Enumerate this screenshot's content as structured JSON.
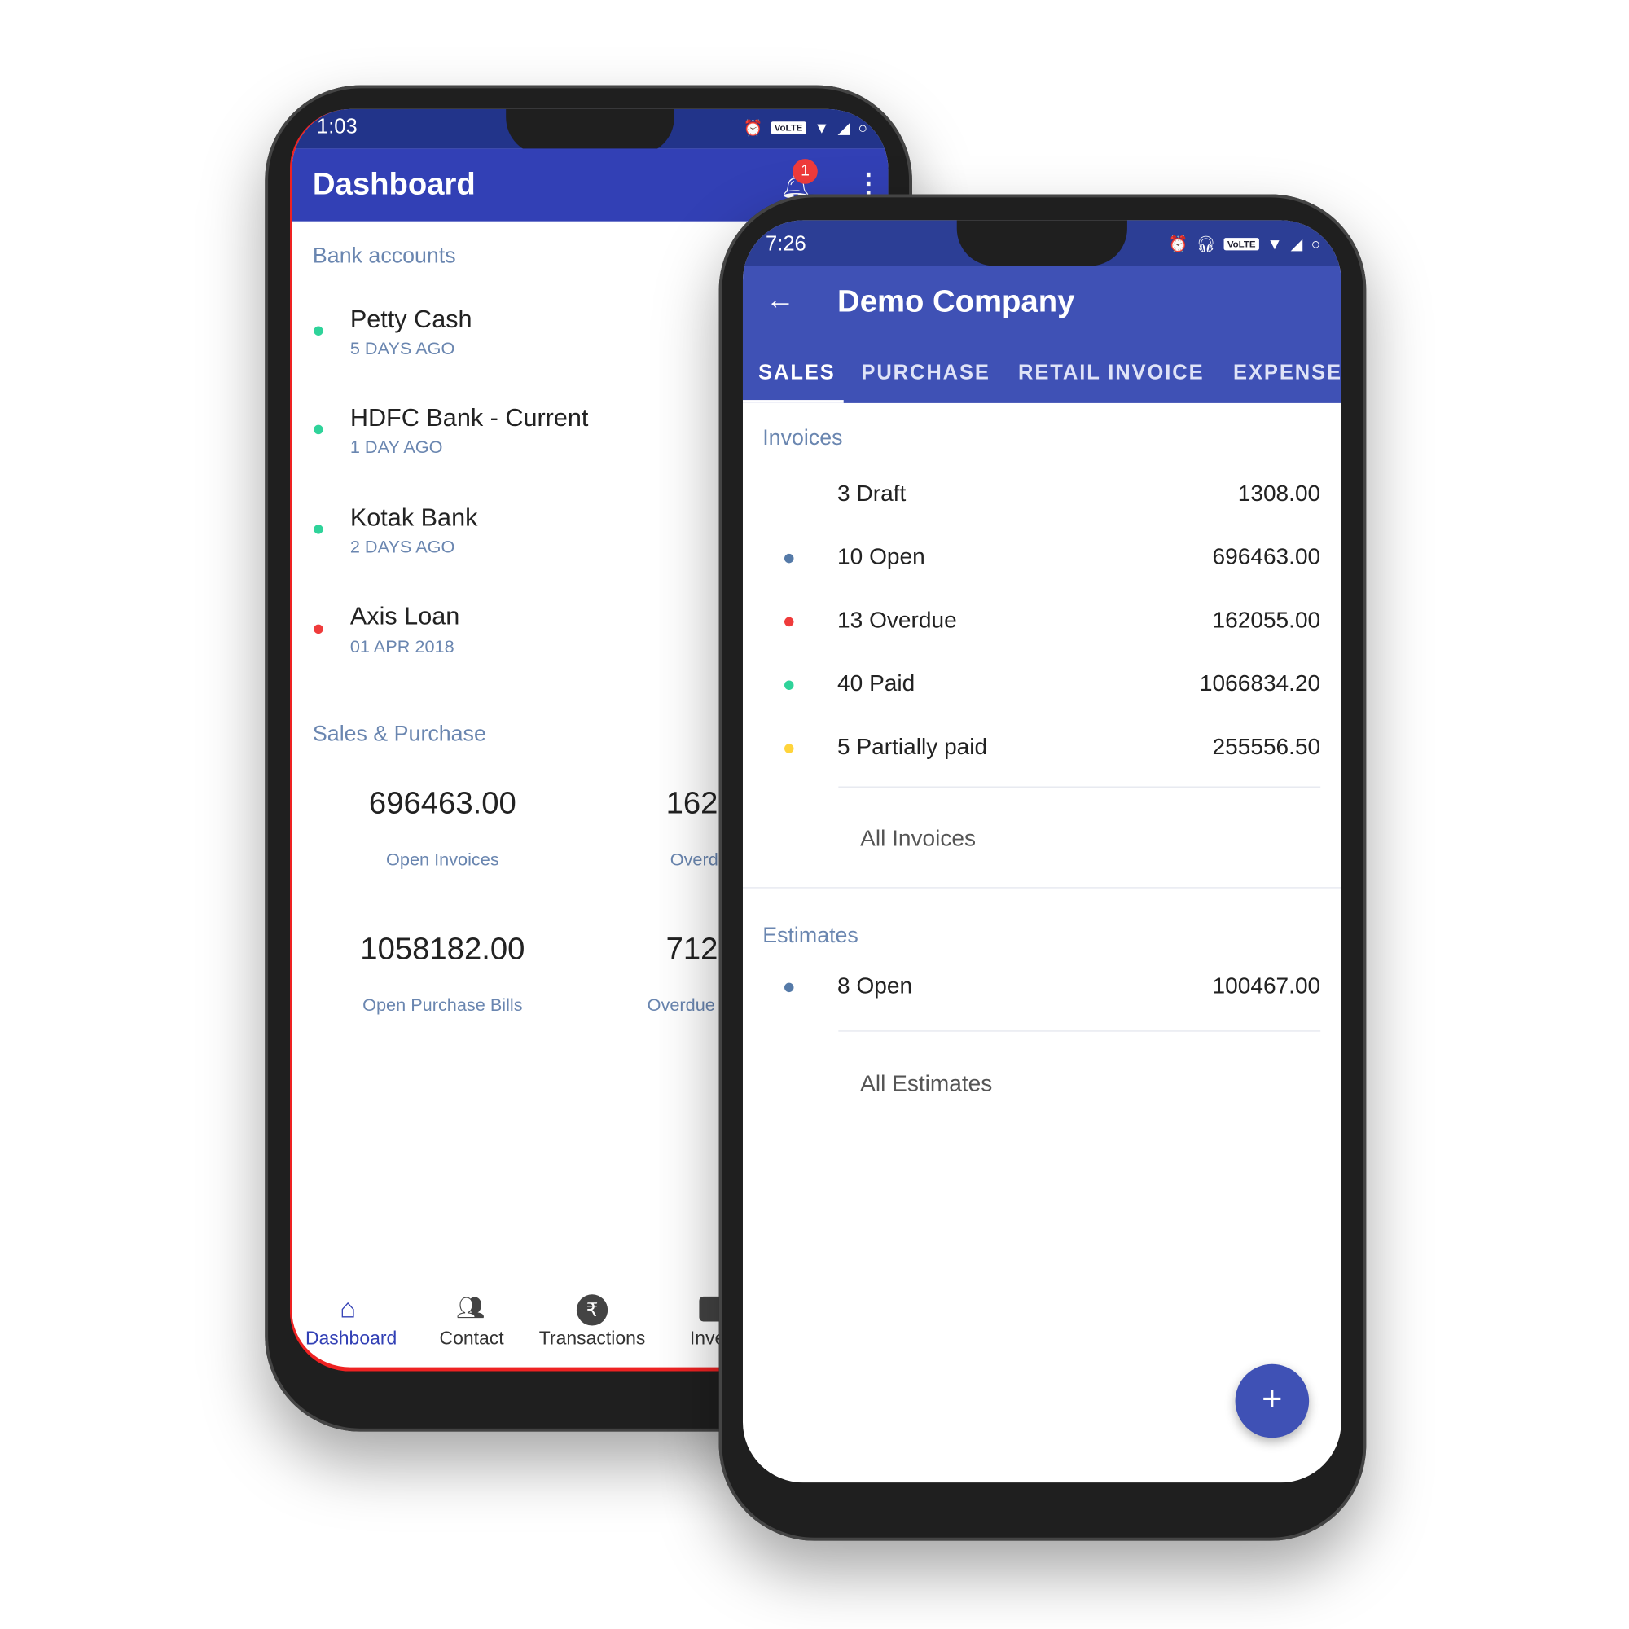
{
  "colors": {
    "primary": "#3240b5",
    "status_bar": "#22348a",
    "accent_text": "#6a86b0",
    "green": "#2fd39a",
    "red": "#ef3b3b",
    "blue": "#557aa8",
    "yellow": "#ffd43b",
    "fab": "#3f51b5"
  },
  "phone1": {
    "status": {
      "time": "1:03",
      "volte": "VoLTE"
    },
    "appbar": {
      "title": "Dashboard",
      "badge": "1"
    },
    "bank": {
      "heading": "Bank accounts",
      "items": [
        {
          "name": "Petty Cash",
          "sub": "5 DAYS AGO",
          "status": "green"
        },
        {
          "name": "HDFC Bank - Current",
          "sub": "1 DAY AGO",
          "status": "green"
        },
        {
          "name": "Kotak Bank",
          "sub": "2 DAYS AGO",
          "status": "green"
        },
        {
          "name": "Axis Loan",
          "sub": "01 APR 2018",
          "status": "red"
        }
      ]
    },
    "sales": {
      "heading": "Sales & Purchase",
      "cards": [
        {
          "value": "696463.00",
          "label": "Open Invoices"
        },
        {
          "value": "162",
          "label": "Overd"
        },
        {
          "value": "1058182.00",
          "label": "Open Purchase Bills"
        },
        {
          "value": "712",
          "label": "Overdue"
        }
      ]
    },
    "nav": [
      {
        "label": "Dashboard",
        "icon": "home-icon",
        "active": true
      },
      {
        "label": "Contact",
        "icon": "people-icon"
      },
      {
        "label": "Transactions",
        "icon": "rupee-icon"
      },
      {
        "label": "Inven",
        "icon": "inventory-icon"
      }
    ]
  },
  "phone2": {
    "status": {
      "time": "7:26",
      "volte": "VoLTE"
    },
    "appbar": {
      "title": "Demo Company"
    },
    "tabs": [
      {
        "label": "SALES",
        "active": true
      },
      {
        "label": "PURCHASE"
      },
      {
        "label": "RETAIL INVOICE"
      },
      {
        "label": "EXPENSE"
      }
    ],
    "invoices": {
      "heading": "Invoices",
      "rows": [
        {
          "label": "3 Draft",
          "amount": "1308.00",
          "status": "none"
        },
        {
          "label": "10 Open",
          "amount": "696463.00",
          "status": "blue"
        },
        {
          "label": "13 Overdue",
          "amount": "162055.00",
          "status": "red"
        },
        {
          "label": "40 Paid",
          "amount": "1066834.20",
          "status": "green"
        },
        {
          "label": "5 Partially paid",
          "amount": "255556.50",
          "status": "yellow"
        }
      ],
      "all_link": "All Invoices"
    },
    "estimates": {
      "heading": "Estimates",
      "rows": [
        {
          "label": "8 Open",
          "amount": "100467.00",
          "status": "blue"
        }
      ],
      "all_link": "All Estimates"
    },
    "fab": "+"
  }
}
